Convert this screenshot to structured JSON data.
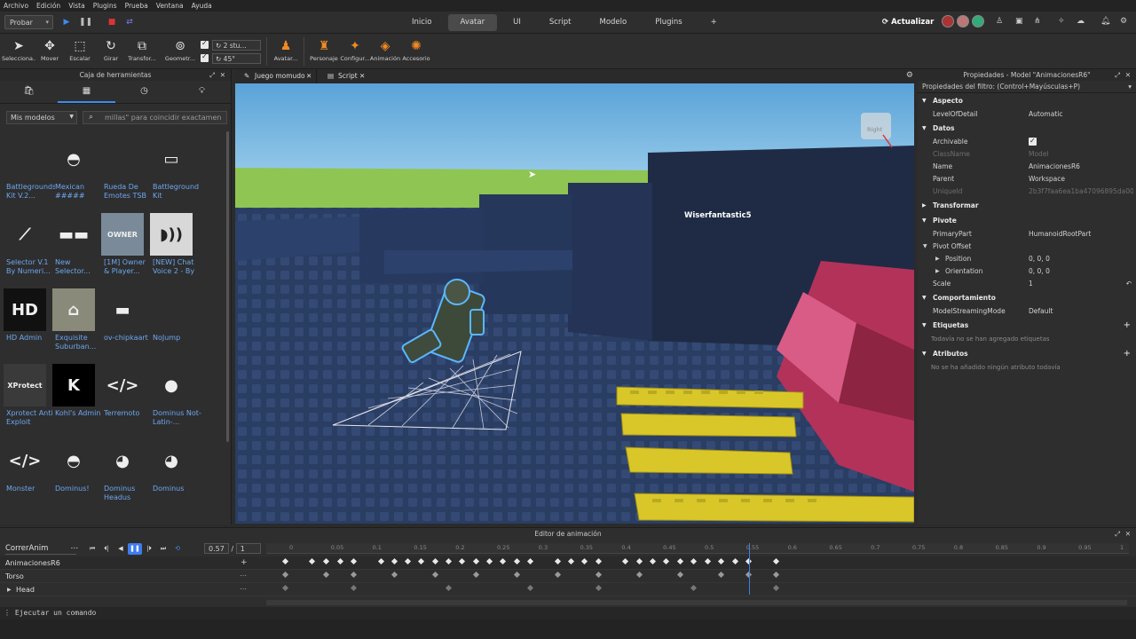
{
  "menu": [
    "Archivo",
    "Edición",
    "Vista",
    "Plugins",
    "Prueba",
    "Ventana",
    "Ayuda"
  ],
  "topbar": {
    "run_mode": "Probar",
    "tabs": [
      "Inicio",
      "Avatar",
      "UI",
      "Script",
      "Modelo",
      "Plugins",
      "+"
    ],
    "active_tab": "Avatar",
    "update_label": "Actualizar"
  },
  "ribbon": {
    "tools": [
      {
        "label": "Selecciona...",
        "icon": "cursor-icon",
        "glyph": "➤"
      },
      {
        "label": "Mover",
        "icon": "move-icon",
        "glyph": "✥"
      },
      {
        "label": "Escalar",
        "icon": "scale-icon",
        "glyph": "⬚"
      },
      {
        "label": "Girar",
        "icon": "rotate-icon",
        "glyph": "↻"
      },
      {
        "label": "Transfor...",
        "icon": "transform-icon",
        "glyph": "⧉"
      },
      {
        "label": "Geometr...",
        "icon": "geometry-icon",
        "glyph": "⊚"
      }
    ],
    "stud_value": "2 stu...",
    "angle_value": "45°",
    "avatar_tools": [
      {
        "label": "Avatar...",
        "icon": "avatar-icon",
        "glyph": "♟"
      },
      {
        "label": "Personaje",
        "icon": "character-icon",
        "glyph": "♜"
      },
      {
        "label": "Configur...",
        "icon": "rig-config-icon",
        "glyph": "✦"
      },
      {
        "label": "Animación",
        "icon": "animation-icon",
        "glyph": "◈"
      },
      {
        "label": "Accesorio",
        "icon": "accessory-icon",
        "glyph": "✺"
      }
    ]
  },
  "toolbox": {
    "title": "Caja de herramientas",
    "category": "Mis modelos",
    "search_placeholder": "millas\" para coincidir exactamen",
    "items": [
      {
        "name": "Battlegrounds Kit V.2...",
        "thumb": "",
        "bg": "#2e2e2e"
      },
      {
        "name": "Mexican #####",
        "thumb": "◓",
        "bg": "#2e2e2e"
      },
      {
        "name": "Rueda De Emotes TSB",
        "thumb": "",
        "bg": "#2e2e2e"
      },
      {
        "name": "Battleground Kit",
        "thumb": "▭",
        "bg": "#2e2e2e"
      },
      {
        "name": "Selector V.1 By Numeri...",
        "thumb": "⟋",
        "bg": "#2e2e2e"
      },
      {
        "name": "New Selector...",
        "thumb": "▬▬",
        "bg": "#2e2e2e"
      },
      {
        "name": "[1M] Owner & Player...",
        "thumb": "OWNER",
        "bg": "#7a8a99"
      },
      {
        "name": "[NEW] Chat Voice 2 - By",
        "thumb": "◗))",
        "bg": "#d8d8d8"
      },
      {
        "name": "HD Admin",
        "thumb": "HD",
        "bg": "#111111"
      },
      {
        "name": "Exquisite Suburban...",
        "thumb": "⌂",
        "bg": "#8a8a7a"
      },
      {
        "name": "ov-chipkaart",
        "thumb": "▬",
        "bg": "#2e2e2e"
      },
      {
        "name": "NoJump",
        "thumb": "",
        "bg": "#2e2e2e"
      },
      {
        "name": "Xprotect Anti Exploit",
        "thumb": "XProtect",
        "bg": "#3a3a3a"
      },
      {
        "name": "Kohl's Admin",
        "thumb": "K",
        "bg": "#000000"
      },
      {
        "name": "Terremoto",
        "thumb": "</>",
        "bg": "#2e2e2e"
      },
      {
        "name": "Dominus Not-Latin-...",
        "thumb": "●",
        "bg": "#2e2e2e"
      },
      {
        "name": "Monster",
        "thumb": "</>",
        "bg": "#2e2e2e"
      },
      {
        "name": "Dominus!",
        "thumb": "◓",
        "bg": "#2e2e2e"
      },
      {
        "name": "Dominus Headus",
        "thumb": "◕",
        "bg": "#2e2e2e"
      },
      {
        "name": "Dominus",
        "thumb": "◕",
        "bg": "#2e2e2e"
      }
    ]
  },
  "viewport": {
    "tabs": [
      "Juego momudo",
      "Script"
    ],
    "player_name": "Wiserfantastic5",
    "view_cube_label": "Right"
  },
  "properties": {
    "title": "Propiedades - Model \"AnimacionesR6\"",
    "filter_placeholder": "Propiedades del filtro: (Control+Mayúsculas+P)",
    "sections": {
      "aspecto": "Aspecto",
      "datos": "Datos",
      "transformar": "Transformar",
      "pivote": "Pivote",
      "comportamiento": "Comportamiento",
      "etiquetas": "Etiquetas",
      "atributos": "Atributos"
    },
    "level_of_detail": {
      "k": "LevelOfDetail",
      "v": "Automatic"
    },
    "archivable": {
      "k": "Archivable"
    },
    "classname": {
      "k": "ClassName",
      "v": "Model"
    },
    "name": {
      "k": "Name",
      "v": "AnimacionesR6"
    },
    "parent": {
      "k": "Parent",
      "v": "Workspace"
    },
    "uniqueid": {
      "k": "UniqueId",
      "v": "2b3f7faa6ea1ba47096895da000..."
    },
    "primarypart": {
      "k": "PrimaryPart",
      "v": "HumanoidRootPart"
    },
    "pivot_offset": {
      "k": "Pivot Offset"
    },
    "position": {
      "k": "Position",
      "v": "0, 0, 0"
    },
    "orientation": {
      "k": "Orientation",
      "v": "0, 0, 0"
    },
    "scale": {
      "k": "Scale",
      "v": "1"
    },
    "streaming": {
      "k": "ModelStreamingMode",
      "v": "Default"
    },
    "tags_note": "Todavía no se han agregado etiquetas",
    "attrs_note": "No se ha añadido ningún atributo todavía"
  },
  "animation_editor": {
    "title": "Editor de animación",
    "anim_name": "CorrerAnim",
    "current_time": "0.57",
    "total_time": "1",
    "ruler": [
      "0",
      "0.05",
      "0.1",
      "0.15",
      "0.2",
      "0.25",
      "0.3",
      "0.35",
      "0.4",
      "0.45",
      "0.5",
      "0.55",
      "0.6",
      "0.65",
      "0.7",
      "0.75",
      "0.8",
      "0.85",
      "0.9",
      "0.95",
      "1"
    ],
    "tracks": [
      "AnimacionesR6",
      "Torso",
      "Head"
    ]
  },
  "command_bar": {
    "placeholder": "Ejecutar un comando"
  }
}
